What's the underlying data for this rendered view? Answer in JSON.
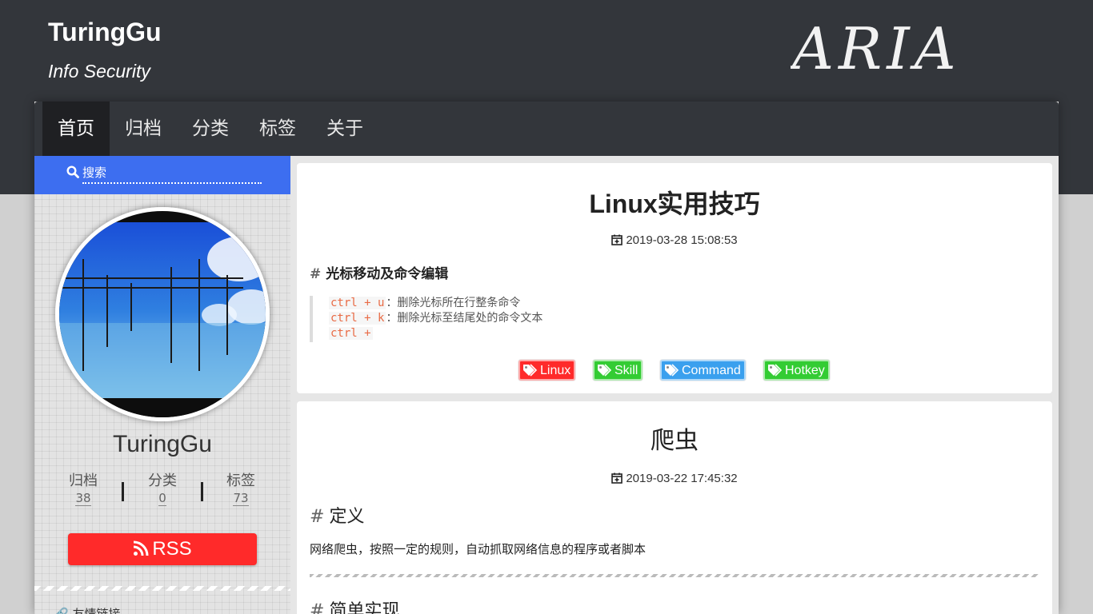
{
  "site": {
    "title": "TuringGu",
    "subtitle": "Info Security",
    "logo_text": "ARIA"
  },
  "nav": {
    "items": [
      {
        "label": "首页",
        "active": true
      },
      {
        "label": "归档"
      },
      {
        "label": "分类"
      },
      {
        "label": "标签"
      },
      {
        "label": "关于"
      }
    ]
  },
  "sidebar": {
    "search_placeholder": "搜索",
    "author_name": "TuringGu",
    "stats": [
      {
        "label": "归档",
        "count": "38"
      },
      {
        "label": "分类",
        "count": "0"
      },
      {
        "label": "标签",
        "count": "73"
      }
    ],
    "rss_label": "RSS",
    "friend_links_label": "友情链接"
  },
  "posts": [
    {
      "title": "Linux实用技巧",
      "date": "2019-03-28 15:08:53",
      "heading": "光标移动及命令编辑",
      "lines": [
        {
          "code": "ctrl + u",
          "text": "：删除光标所在行整条命令"
        },
        {
          "code": "ctrl + k",
          "text": "：删除光标至结尾处的命令文本"
        },
        {
          "code": "ctrl +",
          "text": ""
        }
      ],
      "tags": [
        {
          "label": "Linux",
          "color": "#ff2a2a"
        },
        {
          "label": "Skill",
          "color": "#33cc33"
        },
        {
          "label": "Command",
          "color": "#3aa0ee"
        },
        {
          "label": "Hotkey",
          "color": "#33cc33"
        }
      ]
    },
    {
      "title": "爬虫",
      "date": "2019-03-22 17:45:32",
      "heading1": "定义",
      "paragraph": "网络爬虫，按照一定的规则，自动抓取网络信息的程序或者脚本",
      "heading2": "简单实现"
    }
  ],
  "colors": {
    "header_bg": "#33363b",
    "search_bg": "#3d6ef0",
    "rss_bg": "#ff2a2a"
  }
}
